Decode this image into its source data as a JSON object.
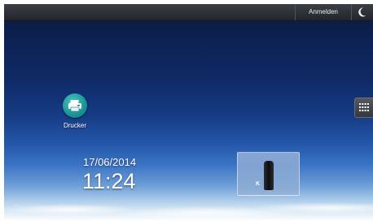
{
  "topbar": {
    "login_label": "Anmelden",
    "moon_icon": "moon-icon"
  },
  "desktop": {
    "printer_app": {
      "label": "Drucker",
      "icon": "printer-icon",
      "accent": "#1a9a9a"
    },
    "clock": {
      "date": "17/06/2014",
      "time": "11:24"
    },
    "toner_widget": {
      "label": "K",
      "icon": "toner-cartridge-icon"
    },
    "apps_button_icon": "grid-icon"
  }
}
